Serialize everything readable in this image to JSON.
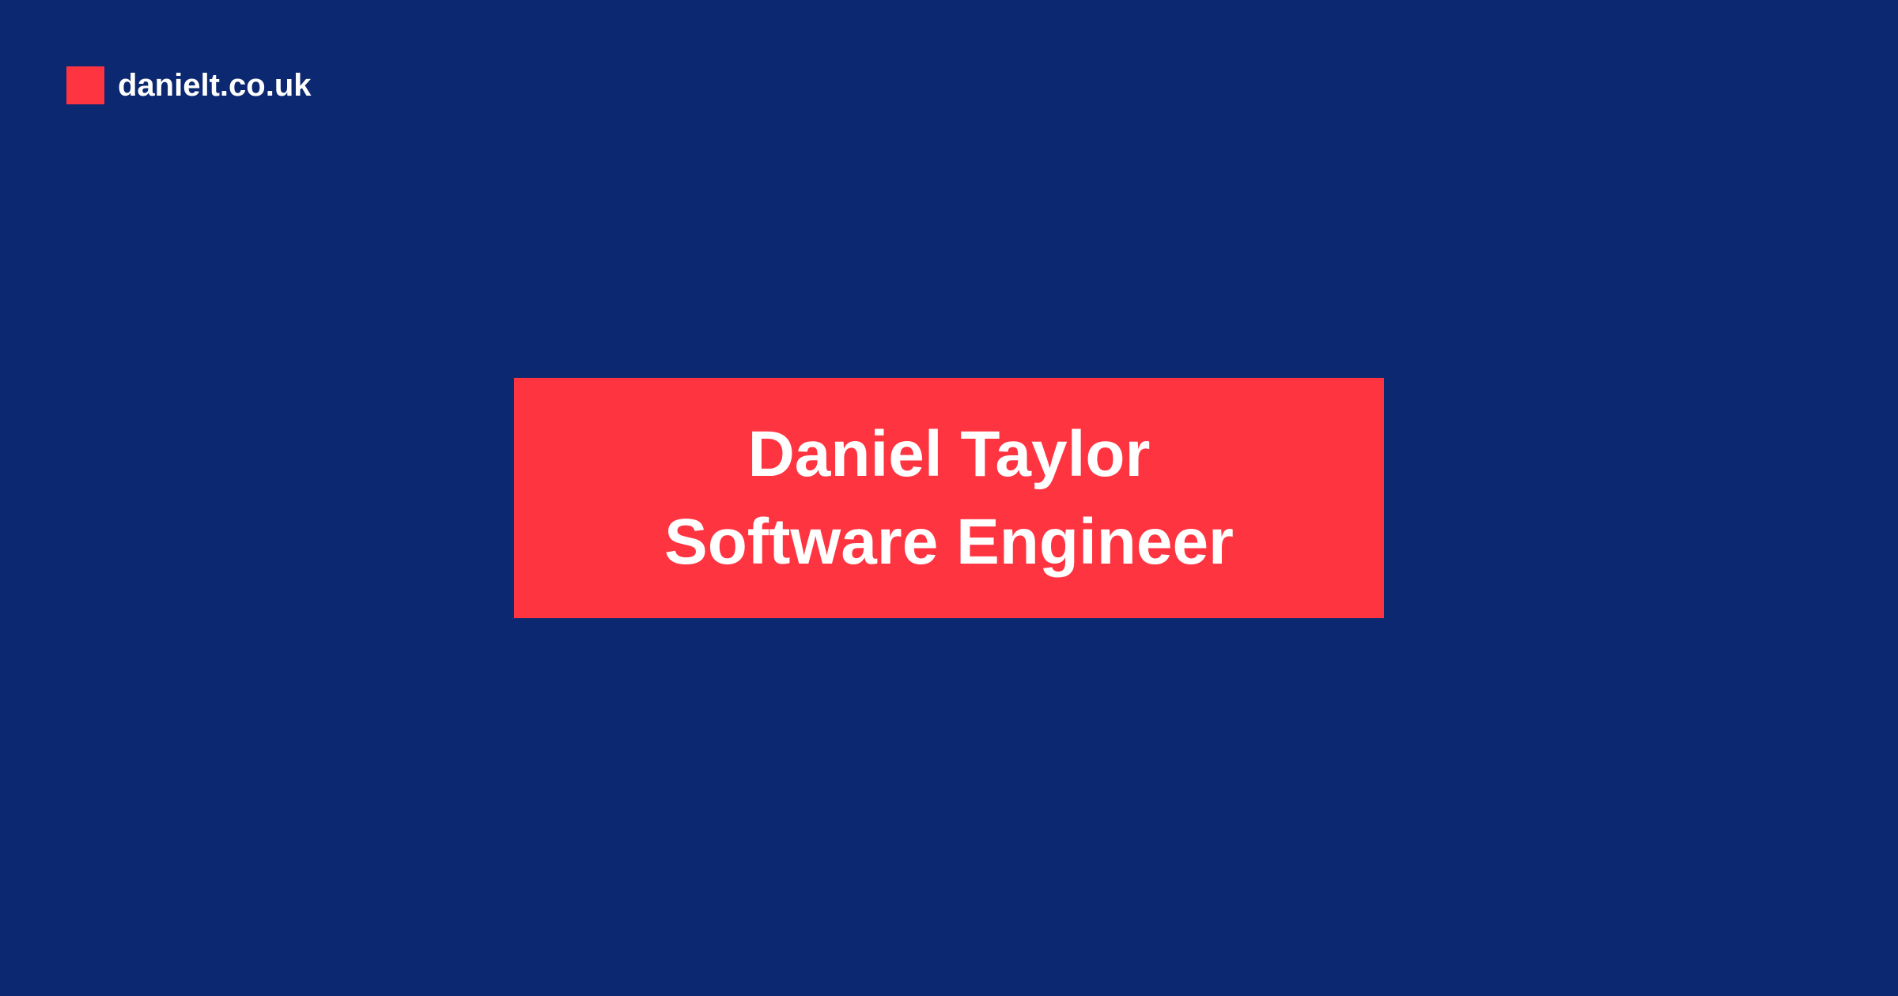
{
  "colors": {
    "background": "#0c2870",
    "accent": "#fe3441",
    "text": "#ffffff"
  },
  "header": {
    "logo_icon": "red-square",
    "site_name": "danielt.co.uk"
  },
  "card": {
    "name": "Daniel Taylor",
    "role": "Software Engineer"
  }
}
